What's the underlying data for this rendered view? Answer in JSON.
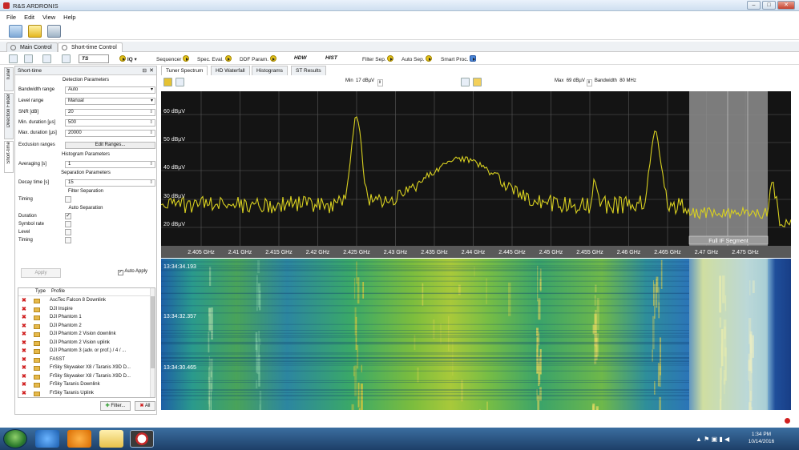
{
  "window": {
    "title": "R&S ARDRONIS",
    "min": "–",
    "max": "□",
    "close": "✕"
  },
  "menu": [
    "File",
    "Edit",
    "View",
    "Help"
  ],
  "main_tabs": [
    "Main Control",
    "Short-time Control"
  ],
  "toolbar": {
    "ts_value": "TS",
    "iq_label": "IQ",
    "sequencer": "Sequencer",
    "spec_eval": "Spec. Eval.",
    "ddf_param": "DDF Param.",
    "hdw": "HDW",
    "hist": "HIST",
    "filter_sep": "Filter Sep.",
    "auto_sep": "Auto Sep.",
    "smart_proc": "Smart Proc."
  },
  "side_tabs": [
    "Tuner",
    "Direction Finder",
    "Short-time"
  ],
  "left_panel": {
    "title": "Short-time",
    "pin": "⊟",
    "close": "✕",
    "detection_header": "Detection Parameters",
    "bandwidth_range": {
      "label": "Bandwidth range",
      "value": "Auto"
    },
    "level_range": {
      "label": "Level range",
      "value": "Manual"
    },
    "snr": {
      "label": "SNR [dB]",
      "value": "20"
    },
    "min_duration": {
      "label": "Min. duration [µs]",
      "value": "500"
    },
    "max_duration": {
      "label": "Max. duration [µs]",
      "value": "20000"
    },
    "exclusion_ranges": {
      "label": "Exclusion ranges",
      "button": "Edit Ranges..."
    },
    "histogram_header": "Histogram Parameters",
    "averaging": {
      "label": "Averaging [s]",
      "value": "1"
    },
    "separation_header": "Separation Parameters",
    "decay_time": {
      "label": "Decay time [s]",
      "value": "15"
    },
    "filter_separation_header": "Filter Separation",
    "timing_filter": {
      "label": "Timing",
      "checked": false
    },
    "auto_separation_header": "Auto Separation",
    "duration": {
      "label": "Duration",
      "checked": true
    },
    "symbol_rate": {
      "label": "Symbol rate",
      "checked": false
    },
    "level": {
      "label": "Level",
      "checked": false
    },
    "timing_auto": {
      "label": "Timing",
      "checked": false
    },
    "apply": "Apply",
    "auto_apply": "Auto Apply",
    "auto_apply_checked": true,
    "profile_headers": {
      "type": "Type",
      "profile": "Profile"
    },
    "profiles": [
      "AscTec Falcon 8 Downlink",
      "DJI Inspire",
      "DJI Phantom 1",
      "DJI Phantom 2",
      "DJI Phantom 2 Vision downlink",
      "DJI Phantom 2 Vision uplink",
      "DJI Phantom 3 (adv. or prof.) / 4 / ...",
      "FASST",
      "FrSky Skywaker X8 / Taranis X9D D...",
      "FrSky Skywaker X8 / Taranis X9D D...",
      "FrSky Taranis Downlink",
      "FrSky Taranis Uplink"
    ],
    "filter_button": "Filter...",
    "all_button": "All"
  },
  "view_tabs": [
    "Tuner Spectrum",
    "HD Waterfall",
    "Histograms",
    "ST Results"
  ],
  "controls": {
    "min_label": "Min",
    "min_value": "17 dBµV",
    "max_label": "Max",
    "max_value": "69 dBµV",
    "bandwidth_label": "Bandwidth",
    "bandwidth_value": "80 MHz"
  },
  "spectrum": {
    "y_ticks": [
      "60 dBµV",
      "50 dBµV",
      "40 dBµV",
      "30 dBµV",
      "20 dBµV"
    ],
    "x_ticks": [
      "2.405 GHz",
      "2.41 GHz",
      "2.415 GHz",
      "2.42 GHz",
      "2.425 GHz",
      "2.43 GHz",
      "2.435 GHz",
      "2.44 GHz",
      "2.445 GHz",
      "2.45 GHz",
      "2.455 GHz",
      "2.46 GHz",
      "2.465 GHz",
      "2.47 GHz",
      "2.475 GHz"
    ],
    "segment_label": "Full IF Segment",
    "trace_color": "#d8d020"
  },
  "waterfall": {
    "timestamps": [
      "13:34:34.193",
      "13:34:32.357",
      "13:34:30.465"
    ]
  },
  "taskbar": {
    "time": "1:34 PM",
    "date": "10/14/2016"
  }
}
